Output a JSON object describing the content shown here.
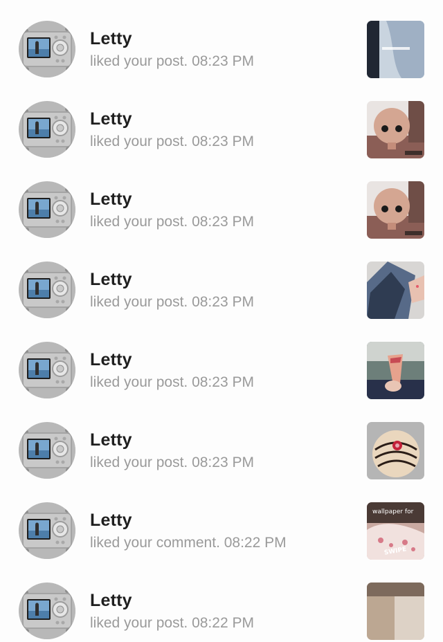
{
  "notifications": [
    {
      "user": "Letty",
      "activity": "liked your post. 08:23 PM",
      "thumb": "blue-shirt-photo",
      "thumb_colors": [
        "#6e7b8a",
        "#9fb0c4",
        "#c9d4df"
      ]
    },
    {
      "user": "Letty",
      "activity": "liked your post. 08:23 PM",
      "thumb": "doll-photo",
      "thumb_colors": [
        "#6b3f35",
        "#d4a692",
        "#e9e4e2"
      ]
    },
    {
      "user": "Letty",
      "activity": "liked your post. 08:23 PM",
      "thumb": "doll-photo",
      "thumb_colors": [
        "#6b3f35",
        "#d4a692",
        "#e9e4e2"
      ]
    },
    {
      "user": "Letty",
      "activity": "liked your post. 08:23 PM",
      "thumb": "denim-photo",
      "thumb_colors": [
        "#2f3c52",
        "#576a88",
        "#d8d6d4"
      ]
    },
    {
      "user": "Letty",
      "activity": "liked your post. 08:23 PM",
      "thumb": "ice-cream-cone-photo",
      "thumb_colors": [
        "#28304a",
        "#6d7f7a",
        "#e6a28d"
      ]
    },
    {
      "user": "Letty",
      "activity": "liked your post. 08:23 PM",
      "thumb": "donut-photo",
      "thumb_colors": [
        "#b5b5b5",
        "#ead7be",
        "#c4223a"
      ]
    },
    {
      "user": "Letty",
      "activity": "liked your comment. 08:22 PM",
      "thumb": "wallpaper-photo",
      "thumb_colors": [
        "#4a3a35",
        "#c9a9a1",
        "#f1e1de"
      ],
      "thumb_text_top": "wallpaper for",
      "thumb_text_bottom": "SWIPE"
    },
    {
      "user": "Letty",
      "activity": "liked your post. 08:22 PM",
      "thumb": "partial-photo",
      "thumb_colors": [
        "#7d6a5c",
        "#bca792",
        "#ddd2c6"
      ]
    }
  ],
  "avatar": {
    "icon": "camera-avatar-icon",
    "colors": {
      "body": "#c9c9c9",
      "screen": "#79a7cf",
      "sea": "#4d7eaa",
      "figure": "#2f2f2f"
    }
  }
}
